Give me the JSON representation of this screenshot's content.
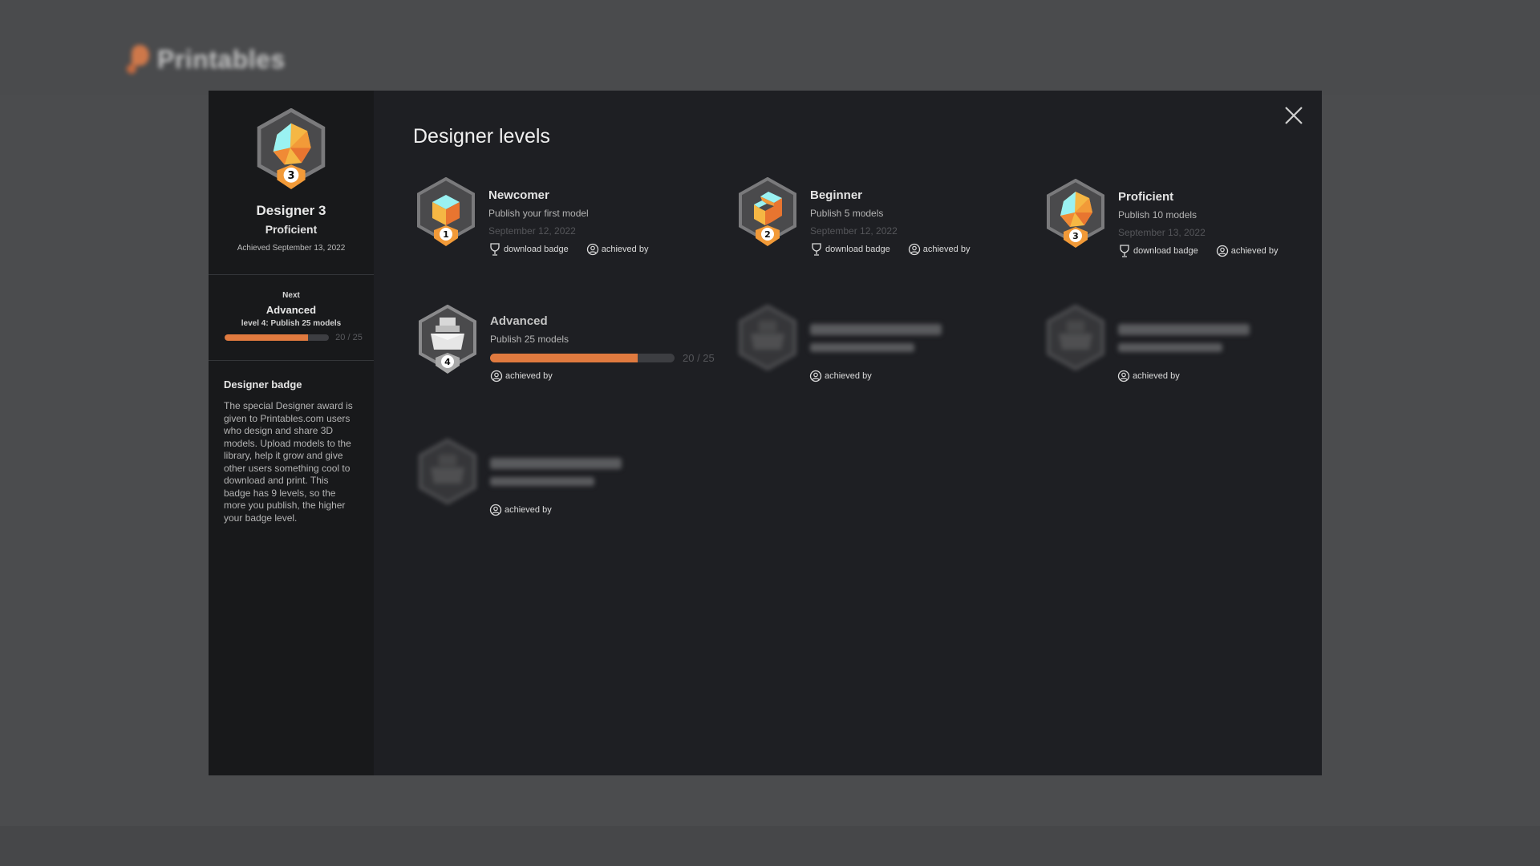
{
  "site": {
    "logo_text": "Printables"
  },
  "sidebar": {
    "badge_title": "Designer 3",
    "badge_level": "Proficient",
    "badge_level_number": "3",
    "achieved_text": "Achieved September 13, 2022",
    "next": {
      "label": "Next",
      "name": "Advanced",
      "description": "level 4: Publish 25 models",
      "progress_text": "20 / 25",
      "progress_current": 20,
      "progress_total": 25
    },
    "about": {
      "title": "Designer badge",
      "text": "The special Designer award is given to Printables.com users who design and share 3D models. Upload models to the library, help it grow and give other users something cool to download and print. This badge has 9 levels, so the more you publish, the higher your badge level."
    }
  },
  "main": {
    "title": "Designer levels",
    "close_label": "close",
    "levels": [
      {
        "number": "1",
        "name": "Newcomer",
        "description": "Publish your first model",
        "date": "September 12, 2022",
        "download_label": "download badge",
        "achieved_label": "achieved by",
        "state": "achieved"
      },
      {
        "number": "2",
        "name": "Beginner",
        "description": "Publish 5 models",
        "date": "September 12, 2022",
        "download_label": "download badge",
        "achieved_label": "achieved by",
        "state": "achieved"
      },
      {
        "number": "3",
        "name": "Proficient",
        "description": "Publish 10 models",
        "date": "September 13, 2022",
        "download_label": "download badge",
        "achieved_label": "achieved by",
        "state": "achieved"
      },
      {
        "number": "4",
        "name": "Advanced",
        "description": "Publish 25 models",
        "progress_text": "20 / 25",
        "progress_current": 20,
        "progress_total": 25,
        "achieved_label": "achieved by",
        "state": "in-progress"
      },
      {
        "achieved_label": "achieved by",
        "state": "locked"
      },
      {
        "achieved_label": "achieved by",
        "state": "locked"
      },
      {
        "achieved_label": "achieved by",
        "state": "locked"
      }
    ]
  },
  "colors": {
    "accent": "#e07a3f",
    "badge_orange": "#f29a38",
    "badge_cyan": "#9af2f2",
    "badge_yellow": "#f5b744"
  }
}
